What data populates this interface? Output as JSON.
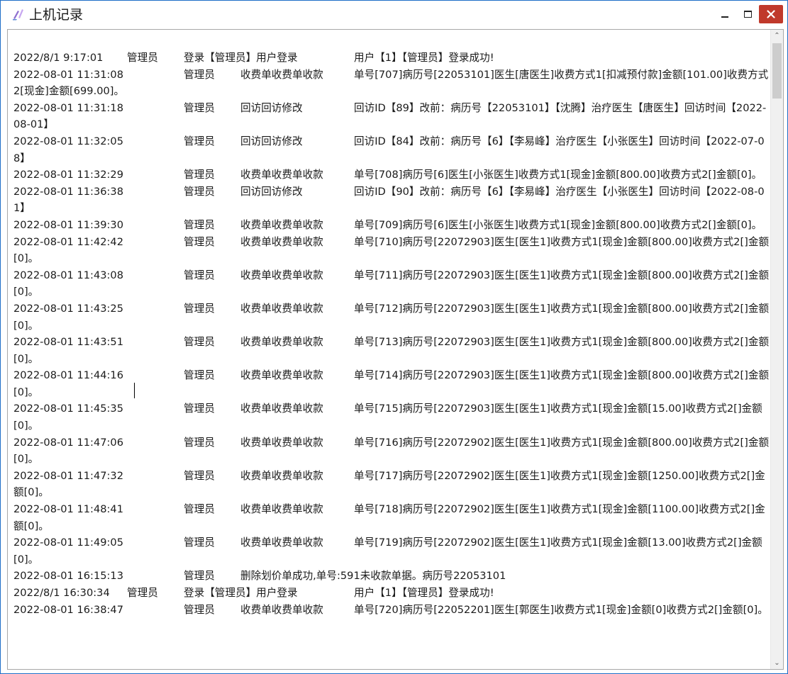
{
  "window": {
    "title": "上机记录",
    "colors": {
      "border": "#1e6ec8",
      "close_button": "#c0392b"
    }
  },
  "log": {
    "rows": [
      {
        "time": "2022/8/1 9:17:01",
        "user": "管理员",
        "module": "登录【管理员】用户登录",
        "desc": "用户【1】【管理员】登录成功!",
        "short": true
      },
      {
        "time": "2022-08-01 11:31:08",
        "user": "管理员",
        "module": "收费单收费单收款",
        "desc": "单号[707]病历号[22053101]医生[唐医生]收费方式1[扣减预付款]金额[101.00]收费方式2[现金]金额[699.00]。"
      },
      {
        "time": "2022-08-01 11:31:18",
        "user": "管理员",
        "module": "回访回访修改",
        "desc": "回访ID【89】改前：病历号【22053101】【沈腾】治疗医生【唐医生】回访时间【2022-08-01】"
      },
      {
        "time": "2022-08-01 11:32:05",
        "user": "管理员",
        "module": "回访回访修改",
        "desc": "回访ID【84】改前：病历号【6】【李易峰】治疗医生【小张医生】回访时间【2022-07-08】"
      },
      {
        "time": "2022-08-01 11:32:29",
        "user": "管理员",
        "module": "收费单收费单收款",
        "desc": "单号[708]病历号[6]医生[小张医生]收费方式1[现金]金额[800.00]收费方式2[]金额[0]。"
      },
      {
        "time": "2022-08-01 11:36:38",
        "user": "管理员",
        "module": "回访回访修改",
        "desc": "回访ID【90】改前：病历号【6】【李易峰】治疗医生【小张医生】回访时间【2022-08-01】"
      },
      {
        "time": "2022-08-01 11:39:30",
        "user": "管理员",
        "module": "收费单收费单收款",
        "desc": "单号[709]病历号[6]医生[小张医生]收费方式1[现金]金额[800.00]收费方式2[]金额[0]。"
      },
      {
        "time": "2022-08-01 11:42:42",
        "user": "管理员",
        "module": "收费单收费单收款",
        "desc": "单号[710]病历号[22072903]医生[医生1]收费方式1[现金]金额[800.00]收费方式2[]金额[0]。"
      },
      {
        "time": "2022-08-01 11:43:08",
        "user": "管理员",
        "module": "收费单收费单收款",
        "desc": "单号[711]病历号[22072903]医生[医生1]收费方式1[现金]金额[800.00]收费方式2[]金额[0]。"
      },
      {
        "time": "2022-08-01 11:43:25",
        "user": "管理员",
        "module": "收费单收费单收款",
        "desc": "单号[712]病历号[22072903]医生[医生1]收费方式1[现金]金额[800.00]收费方式2[]金额[0]。"
      },
      {
        "time": "2022-08-01 11:43:51",
        "user": "管理员",
        "module": "收费单收费单收款",
        "desc": "单号[713]病历号[22072903]医生[医生1]收费方式1[现金]金额[800.00]收费方式2[]金额[0]。"
      },
      {
        "time": "2022-08-01 11:44:16",
        "user": "管理员",
        "module": "收费单收费单收款",
        "desc": "单号[714]病历号[22072903]医生[医生1]收费方式1[现金]金额[800.00]收费方式2[]金额[0]。"
      },
      {
        "time": "2022-08-01 11:45:35",
        "user": "管理员",
        "module": "收费单收费单收款",
        "desc": "单号[715]病历号[22072903]医生[医生1]收费方式1[现金]金额[15.00]收费方式2[]金额[0]。"
      },
      {
        "time": "2022-08-01 11:47:06",
        "user": "管理员",
        "module": "收费单收费单收款",
        "desc": "单号[716]病历号[22072902]医生[医生1]收费方式1[现金]金额[800.00]收费方式2[]金额[0]。"
      },
      {
        "time": "2022-08-01 11:47:32",
        "user": "管理员",
        "module": "收费单收费单收款",
        "desc": "单号[717]病历号[22072902]医生[医生1]收费方式1[现金]金额[1250.00]收费方式2[]金额[0]。"
      },
      {
        "time": "2022-08-01 11:48:41",
        "user": "管理员",
        "module": "收费单收费单收款",
        "desc": "单号[718]病历号[22072902]医生[医生1]收费方式1[现金]金额[1100.00]收费方式2[]金额[0]。"
      },
      {
        "time": "2022-08-01 11:49:05",
        "user": "管理员",
        "module": "收费单收费单收款",
        "desc": "单号[719]病历号[22072902]医生[医生1]收费方式1[现金]金额[13.00]收费方式2[]金额[0]。"
      },
      {
        "time": "2022-08-01 16:15:13",
        "user": "管理员",
        "module": "删除划价单成功,单号:591未收款单据。病历号22053101",
        "desc": "",
        "wide": true
      },
      {
        "time": "2022/8/1 16:30:34",
        "user": "管理员",
        "module": "登录【管理员】用户登录",
        "desc": "用户【1】【管理员】登录成功!",
        "short": true
      },
      {
        "time": "2022-08-01 16:38:47",
        "user": "管理员",
        "module": "收费单收费单收款",
        "desc": "单号[720]病历号[22052201]医生[郭医生]收费方式1[现金]金额[0]收费方式2[]金额[0]。"
      }
    ]
  }
}
